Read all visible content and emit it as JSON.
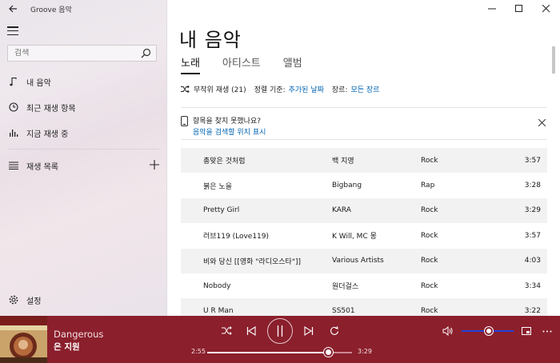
{
  "app": {
    "title": "Groove 음악"
  },
  "search": {
    "placeholder": "검색"
  },
  "sidebar": {
    "items": [
      {
        "label": "내 음악",
        "icon": "music-note-icon"
      },
      {
        "label": "최근 재생 항목",
        "icon": "clock-icon"
      },
      {
        "label": "지금 재생 중",
        "icon": "equalizer-bars-icon"
      },
      {
        "label": "재생 목록",
        "icon": "playlist-icon"
      }
    ],
    "settings_label": "설정"
  },
  "main": {
    "title": "내 음악",
    "tabs": [
      {
        "label": "노래",
        "active": true
      },
      {
        "label": "아티스트",
        "active": false
      },
      {
        "label": "앨범",
        "active": false
      }
    ],
    "toolbar": {
      "shuffle_label": "무작위 재생 (21)",
      "sort_label": "정렬 기준:",
      "sort_value": "추가된 날짜",
      "genre_label": "장르:",
      "genre_value": "모든 장르"
    },
    "notice": {
      "title": "항목을 찾지 못했나요?",
      "link": "음악을 검색할 위치 표시"
    },
    "songs": [
      {
        "title": "총맞은 것처럼",
        "artist": "백 지영",
        "genre": "Rock",
        "duration": "3:57"
      },
      {
        "title": "붉은 노을",
        "artist": "Bigbang",
        "genre": "Rap",
        "duration": "3:28"
      },
      {
        "title": "Pretty Girl",
        "artist": "KARA",
        "genre": "Rock",
        "duration": "3:29"
      },
      {
        "title": "러브119 (Love119)",
        "artist": "K Will, MC 몽",
        "genre": "Rock",
        "duration": "3:57"
      },
      {
        "title": "비와 당신 [[영화 \"라디오스타\"]]",
        "artist": "Various Artists",
        "genre": "Rock",
        "duration": "4:03"
      },
      {
        "title": "Nobody",
        "artist": "원더걸스",
        "genre": "Rock",
        "duration": "3:34"
      },
      {
        "title": "U R Man",
        "artist": "SS501",
        "genre": "Rock",
        "duration": "3:22"
      }
    ]
  },
  "player": {
    "track_title": "Dangerous",
    "artist": "은 지원",
    "elapsed": "2:55",
    "total": "3:29",
    "progress": 0.84,
    "volume": 0.45,
    "accent_color": "#8b1f2c"
  }
}
